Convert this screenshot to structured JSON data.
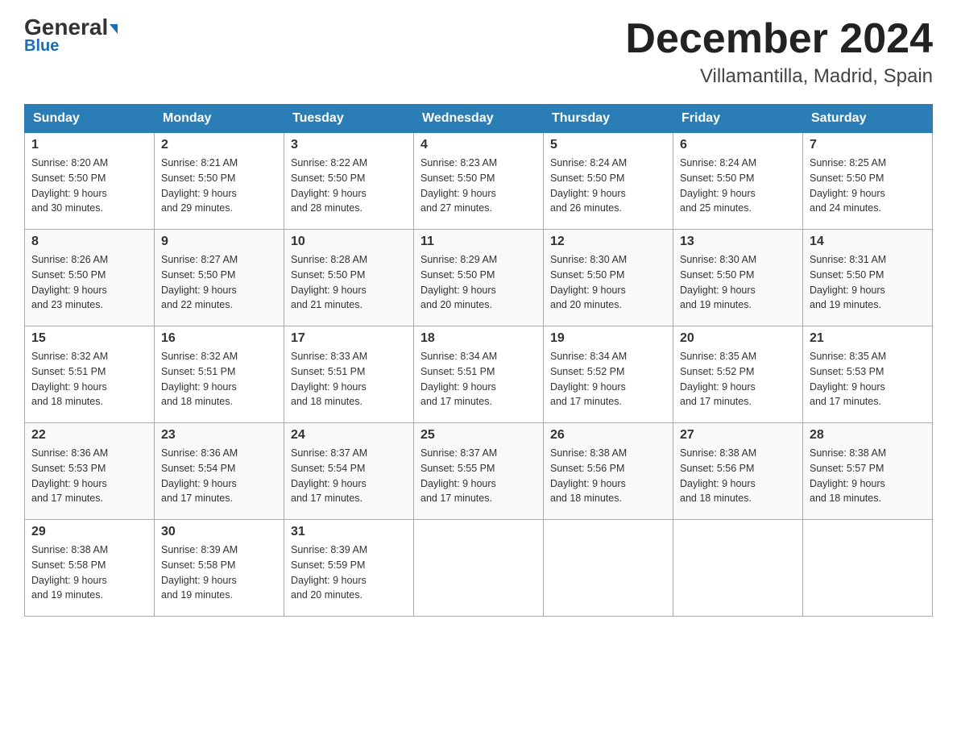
{
  "header": {
    "logo_line1": "General",
    "logo_line2": "Blue",
    "month_title": "December 2024",
    "location": "Villamantilla, Madrid, Spain"
  },
  "weekdays": [
    "Sunday",
    "Monday",
    "Tuesday",
    "Wednesday",
    "Thursday",
    "Friday",
    "Saturday"
  ],
  "weeks": [
    [
      {
        "day": "1",
        "sunrise": "8:20 AM",
        "sunset": "5:50 PM",
        "daylight": "9 hours and 30 minutes."
      },
      {
        "day": "2",
        "sunrise": "8:21 AM",
        "sunset": "5:50 PM",
        "daylight": "9 hours and 29 minutes."
      },
      {
        "day": "3",
        "sunrise": "8:22 AM",
        "sunset": "5:50 PM",
        "daylight": "9 hours and 28 minutes."
      },
      {
        "day": "4",
        "sunrise": "8:23 AM",
        "sunset": "5:50 PM",
        "daylight": "9 hours and 27 minutes."
      },
      {
        "day": "5",
        "sunrise": "8:24 AM",
        "sunset": "5:50 PM",
        "daylight": "9 hours and 26 minutes."
      },
      {
        "day": "6",
        "sunrise": "8:24 AM",
        "sunset": "5:50 PM",
        "daylight": "9 hours and 25 minutes."
      },
      {
        "day": "7",
        "sunrise": "8:25 AM",
        "sunset": "5:50 PM",
        "daylight": "9 hours and 24 minutes."
      }
    ],
    [
      {
        "day": "8",
        "sunrise": "8:26 AM",
        "sunset": "5:50 PM",
        "daylight": "9 hours and 23 minutes."
      },
      {
        "day": "9",
        "sunrise": "8:27 AM",
        "sunset": "5:50 PM",
        "daylight": "9 hours and 22 minutes."
      },
      {
        "day": "10",
        "sunrise": "8:28 AM",
        "sunset": "5:50 PM",
        "daylight": "9 hours and 21 minutes."
      },
      {
        "day": "11",
        "sunrise": "8:29 AM",
        "sunset": "5:50 PM",
        "daylight": "9 hours and 20 minutes."
      },
      {
        "day": "12",
        "sunrise": "8:30 AM",
        "sunset": "5:50 PM",
        "daylight": "9 hours and 20 minutes."
      },
      {
        "day": "13",
        "sunrise": "8:30 AM",
        "sunset": "5:50 PM",
        "daylight": "9 hours and 19 minutes."
      },
      {
        "day": "14",
        "sunrise": "8:31 AM",
        "sunset": "5:50 PM",
        "daylight": "9 hours and 19 minutes."
      }
    ],
    [
      {
        "day": "15",
        "sunrise": "8:32 AM",
        "sunset": "5:51 PM",
        "daylight": "9 hours and 18 minutes."
      },
      {
        "day": "16",
        "sunrise": "8:32 AM",
        "sunset": "5:51 PM",
        "daylight": "9 hours and 18 minutes."
      },
      {
        "day": "17",
        "sunrise": "8:33 AM",
        "sunset": "5:51 PM",
        "daylight": "9 hours and 18 minutes."
      },
      {
        "day": "18",
        "sunrise": "8:34 AM",
        "sunset": "5:51 PM",
        "daylight": "9 hours and 17 minutes."
      },
      {
        "day": "19",
        "sunrise": "8:34 AM",
        "sunset": "5:52 PM",
        "daylight": "9 hours and 17 minutes."
      },
      {
        "day": "20",
        "sunrise": "8:35 AM",
        "sunset": "5:52 PM",
        "daylight": "9 hours and 17 minutes."
      },
      {
        "day": "21",
        "sunrise": "8:35 AM",
        "sunset": "5:53 PM",
        "daylight": "9 hours and 17 minutes."
      }
    ],
    [
      {
        "day": "22",
        "sunrise": "8:36 AM",
        "sunset": "5:53 PM",
        "daylight": "9 hours and 17 minutes."
      },
      {
        "day": "23",
        "sunrise": "8:36 AM",
        "sunset": "5:54 PM",
        "daylight": "9 hours and 17 minutes."
      },
      {
        "day": "24",
        "sunrise": "8:37 AM",
        "sunset": "5:54 PM",
        "daylight": "9 hours and 17 minutes."
      },
      {
        "day": "25",
        "sunrise": "8:37 AM",
        "sunset": "5:55 PM",
        "daylight": "9 hours and 17 minutes."
      },
      {
        "day": "26",
        "sunrise": "8:38 AM",
        "sunset": "5:56 PM",
        "daylight": "9 hours and 18 minutes."
      },
      {
        "day": "27",
        "sunrise": "8:38 AM",
        "sunset": "5:56 PM",
        "daylight": "9 hours and 18 minutes."
      },
      {
        "day": "28",
        "sunrise": "8:38 AM",
        "sunset": "5:57 PM",
        "daylight": "9 hours and 18 minutes."
      }
    ],
    [
      {
        "day": "29",
        "sunrise": "8:38 AM",
        "sunset": "5:58 PM",
        "daylight": "9 hours and 19 minutes."
      },
      {
        "day": "30",
        "sunrise": "8:39 AM",
        "sunset": "5:58 PM",
        "daylight": "9 hours and 19 minutes."
      },
      {
        "day": "31",
        "sunrise": "8:39 AM",
        "sunset": "5:59 PM",
        "daylight": "9 hours and 20 minutes."
      },
      null,
      null,
      null,
      null
    ]
  ],
  "labels": {
    "sunrise": "Sunrise:",
    "sunset": "Sunset:",
    "daylight": "Daylight:"
  }
}
